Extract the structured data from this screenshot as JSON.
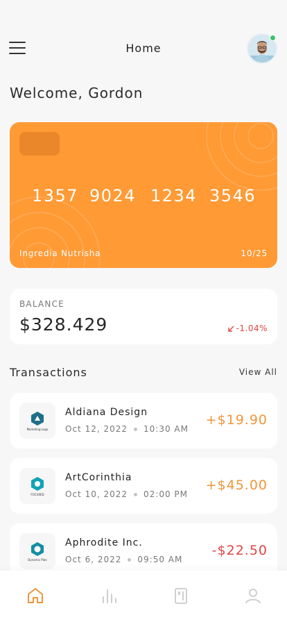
{
  "header": {
    "title": "Home",
    "menu_icon": "hamburger-menu-icon",
    "online_status_color": "#3cc36b"
  },
  "welcome_text": "Welcome, Gordon",
  "card": {
    "number_groups": [
      "1357",
      "9024",
      "1234",
      "3546"
    ],
    "holder": "Ingredia Nutrisha",
    "expiry": "10/25",
    "color": "#ff9a35"
  },
  "balance": {
    "label": "BALANCE",
    "amount": "$328.429",
    "change": "-1.04%",
    "change_icon": "arrow-down-left-icon",
    "change_color": "#e04545"
  },
  "transactions": {
    "title": "Transactions",
    "view_all": "View All",
    "items": [
      {
        "name": "Aldiana Design",
        "date": "Oct 12, 2022",
        "time": "10:30 AM",
        "amount": "+$19.90",
        "logo_caption": "Marketing Logo",
        "amount_color": "#f0953a"
      },
      {
        "name": "ArtCorinthia",
        "date": "Oct 10, 2022",
        "time": "02:00 PM",
        "amount": "+$45.00",
        "logo_caption": "FOCUSED",
        "amount_color": "#f0953a"
      },
      {
        "name": "Aphrodite Inc.",
        "date": "Oct 6, 2022",
        "time": "09:50 AM",
        "amount": "-$22.50",
        "logo_caption": "Dynamic Plan",
        "amount_color": "#e04545"
      }
    ]
  },
  "bottom_nav": {
    "items": [
      "home-icon",
      "chart-bars-icon",
      "card-icon",
      "user-icon"
    ],
    "active": "home-icon",
    "active_color": "#f0953a",
    "inactive_color": "#cfcfcf"
  }
}
